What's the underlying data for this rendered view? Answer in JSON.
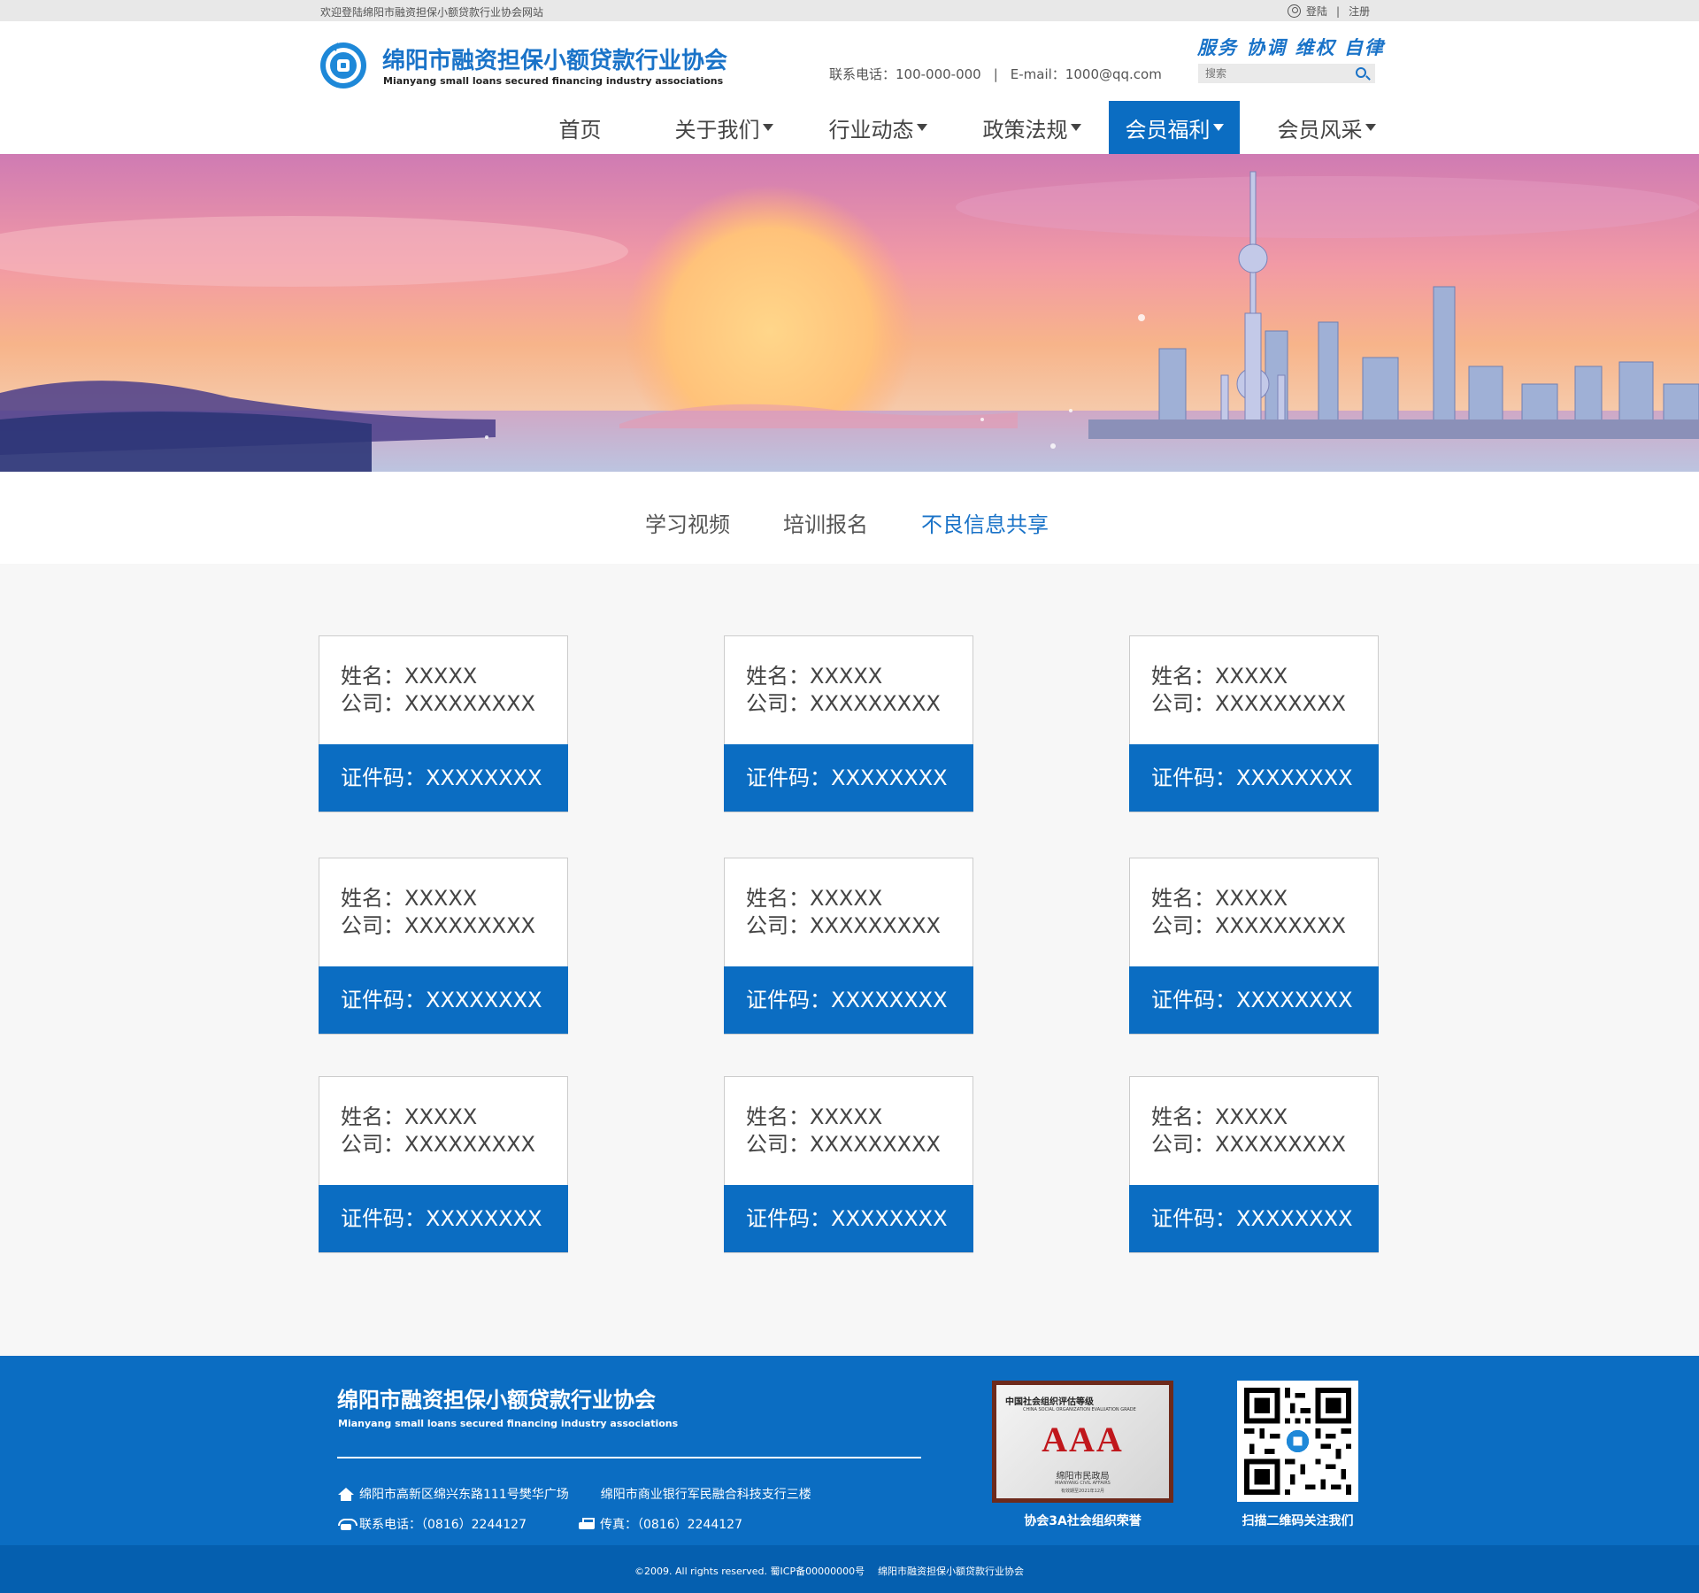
{
  "topbar": {
    "welcome": "欢迎登陆绵阳市融资担保小额贷款行业协会网站",
    "login": "登陆",
    "separator": "|",
    "register": "注册"
  },
  "header": {
    "title_cn": "绵阳市融资担保小额贷款行业协会",
    "title_en": "Mianyang small loans secured financing industry associations",
    "slogan": "服务 协调 维权 自律",
    "phone": "联系电话：100-000-000",
    "separator": "|",
    "email": "E-mail：1000@qq.com",
    "search_placeholder": "搜索"
  },
  "nav": [
    {
      "label": "首页",
      "dropdown": false,
      "active": false
    },
    {
      "label": "关于我们",
      "dropdown": true,
      "active": false
    },
    {
      "label": "行业动态",
      "dropdown": true,
      "active": false
    },
    {
      "label": "政策法规",
      "dropdown": true,
      "active": false
    },
    {
      "label": "会员福利",
      "dropdown": true,
      "active": true
    },
    {
      "label": "会员风采",
      "dropdown": true,
      "active": false
    }
  ],
  "subtabs": [
    {
      "label": "学习视频",
      "active": false
    },
    {
      "label": "培训报名",
      "active": false
    },
    {
      "label": "不良信息共享",
      "active": true
    }
  ],
  "cards": [
    {
      "name": "姓名：XXXXX",
      "company": "公司：XXXXXXXXX",
      "cert": "证件码：XXXXXXXX"
    },
    {
      "name": "姓名：XXXXX",
      "company": "公司：XXXXXXXXX",
      "cert": "证件码：XXXXXXXX"
    },
    {
      "name": "姓名：XXXXX",
      "company": "公司：XXXXXXXXX",
      "cert": "证件码：XXXXXXXX"
    },
    {
      "name": "姓名：XXXXX",
      "company": "公司：XXXXXXXXX",
      "cert": "证件码：XXXXXXXX"
    },
    {
      "name": "姓名：XXXXX",
      "company": "公司：XXXXXXXXX",
      "cert": "证件码：XXXXXXXX"
    },
    {
      "name": "姓名：XXXXX",
      "company": "公司：XXXXXXXXX",
      "cert": "证件码：XXXXXXXX"
    },
    {
      "name": "姓名：XXXXX",
      "company": "公司：XXXXXXXXX",
      "cert": "证件码：XXXXXXXX"
    },
    {
      "name": "姓名：XXXXX",
      "company": "公司：XXXXXXXXX",
      "cert": "证件码：XXXXXXXX"
    },
    {
      "name": "姓名：XXXXX",
      "company": "公司：XXXXXXXXX",
      "cert": "证件码：XXXXXXXX"
    }
  ],
  "footer": {
    "title_cn": "绵阳市融资担保小额贷款行业协会",
    "title_en": "Mianyang small loans secured financing industry associations",
    "address1": "绵阳市高新区绵兴东路111号樊华广场",
    "address2": "绵阳市商业银行军民融合科技支行三楼",
    "phone": "联系电话：（0816）2244127",
    "fax": "传真：（0816）2244127",
    "award": {
      "org": "中国社会组织评估等级",
      "org_en": "CHINA SOCIAL ORGANIZATION EVALUATION GRADE",
      "grade": "AAA",
      "issuer": "绵阳市民政局",
      "issuer_en": "MIANYANG CIVIL AFFAIRS",
      "date": "有效期至2021年12月"
    },
    "award_caption": "协会3A社会组织荣誉",
    "qr_caption": "扫描二维码关注我们"
  },
  "bottom": {
    "copyright": "©2009. All rights reserved. 蜀ICP备00000000号",
    "org": "绵阳市融资担保小额贷款行业协会"
  },
  "colors": {
    "brand": "#0b6dc2",
    "footer_bottom": "#055faf",
    "award_red": "#c0171c"
  }
}
